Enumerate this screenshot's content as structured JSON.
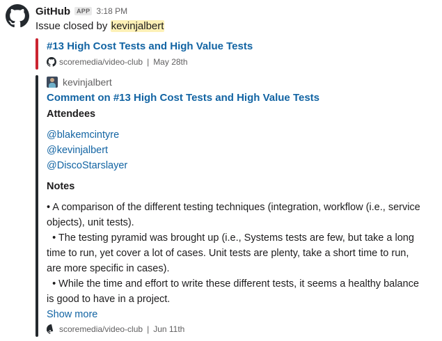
{
  "message": {
    "sender": "GitHub",
    "badge": "APP",
    "time": "3:18 PM",
    "text_prefix": "Issue closed by",
    "mention": "kevinjalbert"
  },
  "attachment_issue": {
    "title": "#13 High Cost Tests and High Value Tests",
    "repo": "scoremedia/video-club",
    "date": "May 28th",
    "bar_color": "#cb2431"
  },
  "attachment_comment": {
    "author": "kevinjalbert",
    "title": "Comment on #13 High Cost Tests and High Value Tests",
    "attendees_heading": "Attendees",
    "attendees": [
      "@blakemcintyre",
      "@kevinjalbert",
      "@DiscoStarslayer"
    ],
    "notes_heading": "Notes",
    "notes": [
      "• A comparison of the different testing techniques (integration, workflow (i.e., service objects), unit tests).",
      "  • The testing pyramid was brought up (i.e., Systems tests are few, but take a long time to run, yet cover a lot of cases. Unit tests are plenty, take a short time to run, are more specific in cases).",
      "  • While the time and effort to write these different tests, it seems a healthy balance is good to have in a project."
    ],
    "show_more": "Show more",
    "repo": "scoremedia/video-club",
    "date": "Jun 11th",
    "bar_color": "#24292e"
  },
  "icons": {
    "avatar": "github-octocat-icon",
    "footer": "github-mini-icon"
  },
  "colors": {
    "link": "#1264a3",
    "mention_bg": "#fdf0b6"
  }
}
